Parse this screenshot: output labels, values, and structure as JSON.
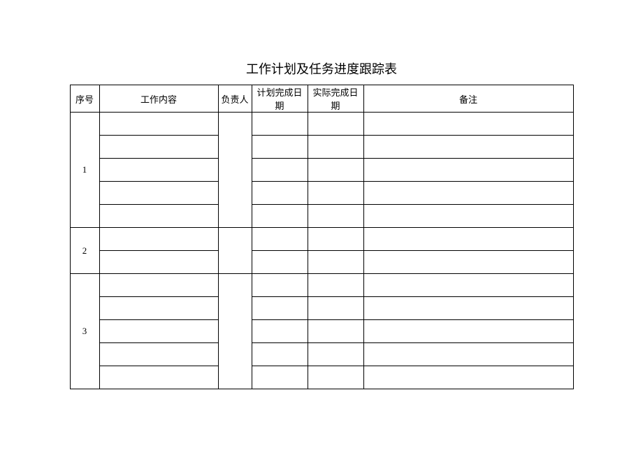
{
  "title": "工作计划及任务进度跟踪表",
  "headers": {
    "seq": "序号",
    "content": "工作内容",
    "person": "负责人",
    "planDate": "计划完成日期",
    "actualDate": "实际完成日期",
    "remarks": "备注"
  },
  "groups": [
    {
      "seq": "1",
      "rows": [
        {
          "content": "",
          "planDate": "",
          "actualDate": "",
          "remarks": ""
        },
        {
          "content": "",
          "planDate": "",
          "actualDate": "",
          "remarks": ""
        },
        {
          "content": "",
          "planDate": "",
          "actualDate": "",
          "remarks": ""
        },
        {
          "content": "",
          "planDate": "",
          "actualDate": "",
          "remarks": ""
        },
        {
          "content": "",
          "planDate": "",
          "actualDate": "",
          "remarks": ""
        }
      ],
      "person": ""
    },
    {
      "seq": "2",
      "rows": [
        {
          "content": "",
          "planDate": "",
          "actualDate": "",
          "remarks": ""
        },
        {
          "content": "",
          "planDate": "",
          "actualDate": "",
          "remarks": ""
        }
      ],
      "person": ""
    },
    {
      "seq": "3",
      "rows": [
        {
          "content": "",
          "planDate": "",
          "actualDate": "",
          "remarks": ""
        },
        {
          "content": "",
          "planDate": "",
          "actualDate": "",
          "remarks": ""
        },
        {
          "content": "",
          "planDate": "",
          "actualDate": "",
          "remarks": ""
        },
        {
          "content": "",
          "planDate": "",
          "actualDate": "",
          "remarks": ""
        },
        {
          "content": "",
          "planDate": "",
          "actualDate": "",
          "remarks": ""
        }
      ],
      "person": ""
    }
  ]
}
